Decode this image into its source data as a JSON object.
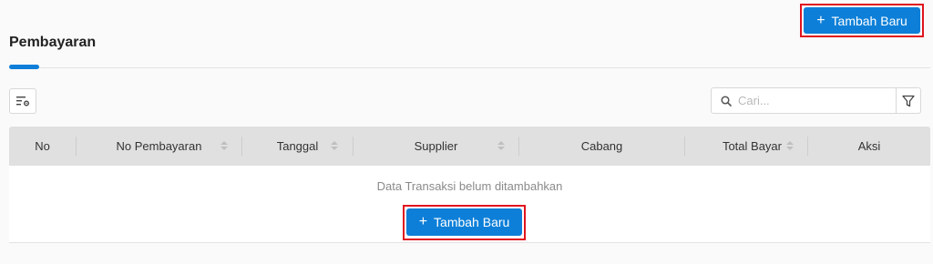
{
  "header": {
    "title": "Pembayaran",
    "add_button_label": "Tambah Baru",
    "add_button_icon": "plus-icon"
  },
  "toolbar": {
    "column_settings_icon": "column-settings-icon",
    "search_placeholder": "Cari...",
    "search_value": "",
    "filter_icon": "filter-icon"
  },
  "table": {
    "columns": [
      {
        "label": "No",
        "sortable": false
      },
      {
        "label": "No Pembayaran",
        "sortable": true
      },
      {
        "label": "Tanggal",
        "sortable": true
      },
      {
        "label": "Supplier",
        "sortable": true
      },
      {
        "label": "Cabang",
        "sortable": false
      },
      {
        "label": "Total Bayar",
        "sortable": true
      },
      {
        "label": "Aksi",
        "sortable": false
      }
    ],
    "empty_message": "Data Transaksi belum ditambahkan",
    "empty_add_button_label": "Tambah Baru"
  },
  "colors": {
    "primary": "#0d7fd8",
    "highlight": "#e0141e",
    "header_bg": "#e0e0e0"
  }
}
